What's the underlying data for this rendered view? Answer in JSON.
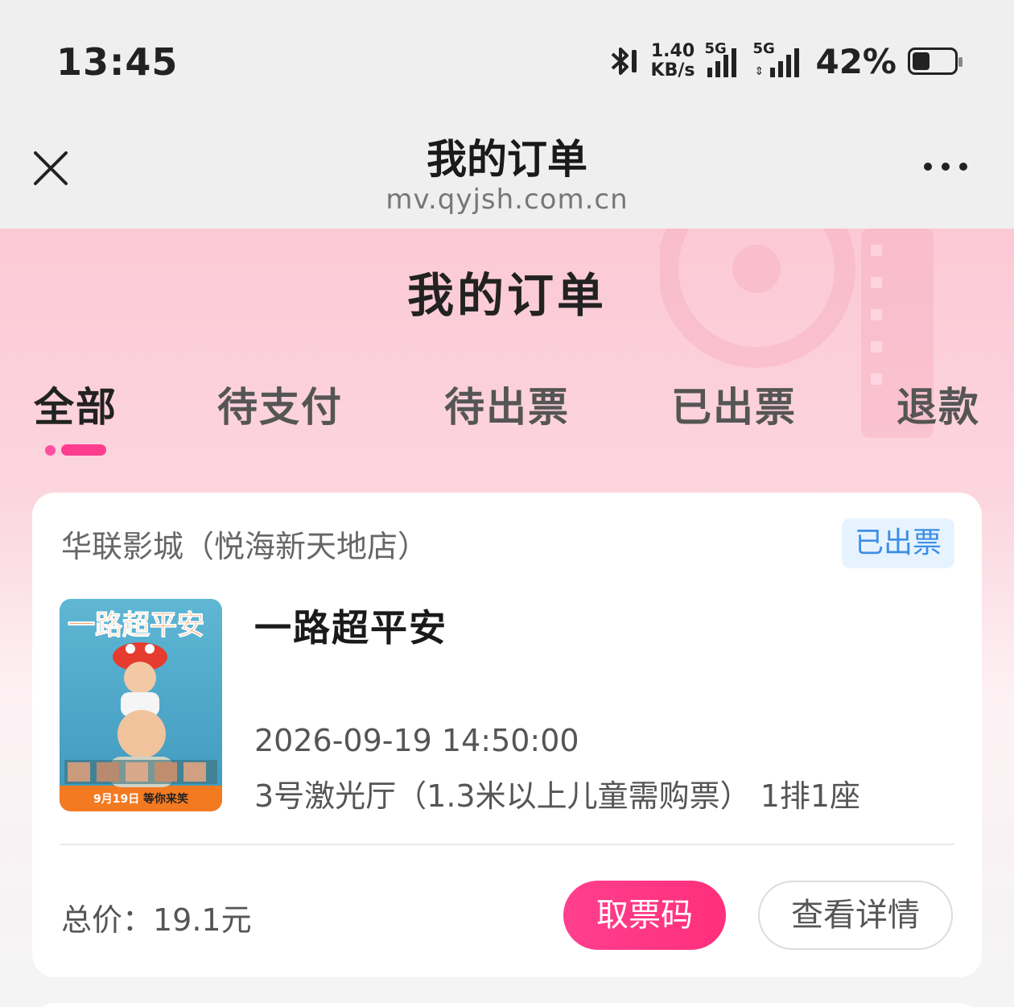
{
  "status_bar": {
    "time": "13:45",
    "net_speed_value": "1.40",
    "net_speed_unit": "KB/s",
    "sim1_label": "5G",
    "sim2_label": "5G",
    "battery_percent": "42%",
    "battery_level": 0.42,
    "icons": [
      "bluetooth-icon",
      "signal-icon",
      "signal-icon",
      "battery-icon"
    ]
  },
  "nav": {
    "title": "我的订单",
    "url": "mv.qyjsh.com.cn",
    "close_icon": "close-icon",
    "more_icon": "more-icon"
  },
  "page": {
    "title": "我的订单",
    "tabs": [
      {
        "label": "全部",
        "active": true
      },
      {
        "label": "待支付",
        "active": false
      },
      {
        "label": "待出票",
        "active": false
      },
      {
        "label": "已出票",
        "active": false
      },
      {
        "label": "退款",
        "active": false
      }
    ]
  },
  "order": {
    "cinema": "华联影城（悦海新天地店）",
    "status": "已出票",
    "movie_title": "一路超平安",
    "poster": {
      "title_art": "一路超平安",
      "release": "9月19日",
      "tagline": "等你来笑"
    },
    "showtime": "2026-09-19 14:50:00",
    "hall_seat": "3号激光厅（1.3米以上儿童需购票） 1排1座",
    "total": "总价：19.1元",
    "btn_code": "取票码",
    "btn_detail": "查看详情"
  },
  "colors": {
    "accent": "#ff3d8e",
    "badge_bg": "#e6f3ff",
    "badge_text": "#3d8ee6"
  }
}
